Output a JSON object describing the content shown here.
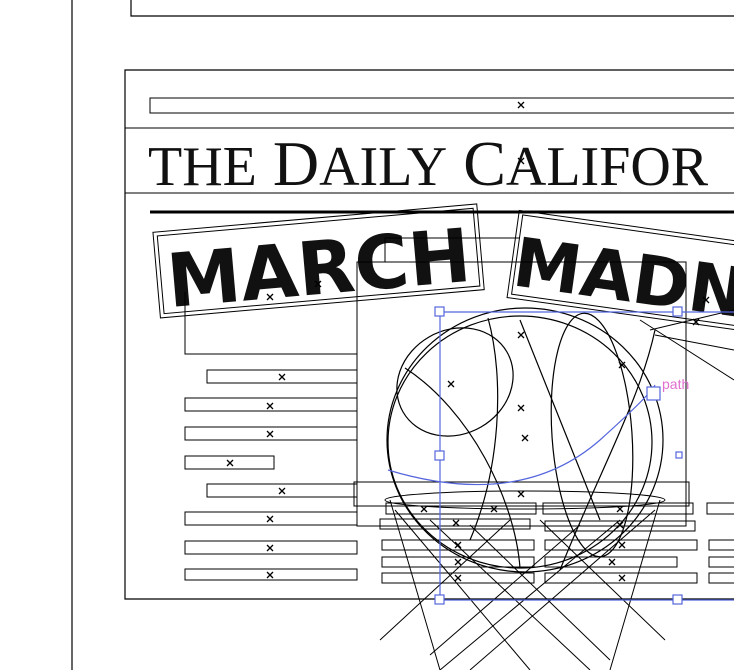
{
  "masthead": {
    "title_the": "THE",
    "title_daily_d": "D",
    "title_daily_rest": "AILY",
    "title_cal_c": "C",
    "title_cal_rest": "ALIFOR"
  },
  "headline": {
    "word1": "MARCH",
    "word2": "MADN"
  },
  "selection": {
    "label": "path",
    "color": "#5566dd",
    "label_color": "#e070d0"
  },
  "icons": {
    "anchor_marker": "x-mark-icon",
    "handle": "square-handle-icon"
  }
}
